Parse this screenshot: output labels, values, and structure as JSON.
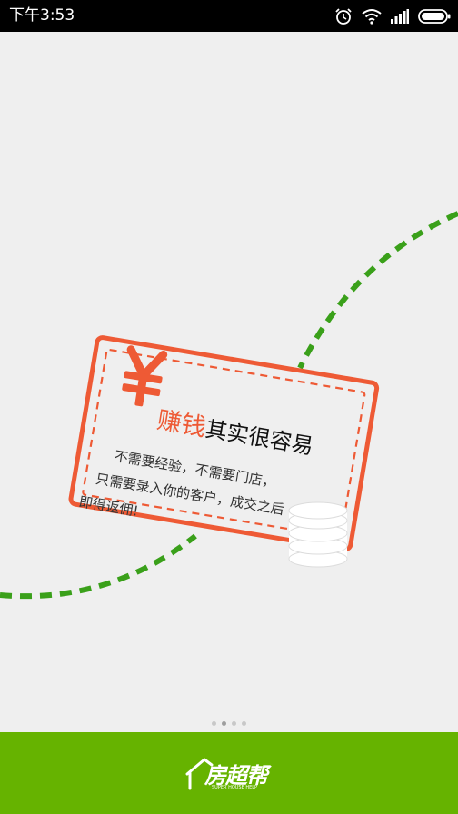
{
  "status_bar": {
    "time": "下午3:53",
    "icons": [
      "alarm-icon",
      "wifi-icon",
      "signal-icon",
      "battery-icon"
    ]
  },
  "card": {
    "headline_red": "赚钱",
    "headline_black": "其实很容易",
    "lines": [
      "不需要经验，不需要门店，",
      "只需要录入你的客户，成交之后",
      "即得返佣!"
    ],
    "currency_symbol": "¥"
  },
  "pager": {
    "total": 4,
    "active_index": 1
  },
  "brand": {
    "name": "房超帮",
    "tagline": "SUPER HOUSE HELP",
    "color": "#66b300"
  },
  "colors": {
    "accent_red": "#ee5a35",
    "dash_green": "#3aa01a"
  }
}
